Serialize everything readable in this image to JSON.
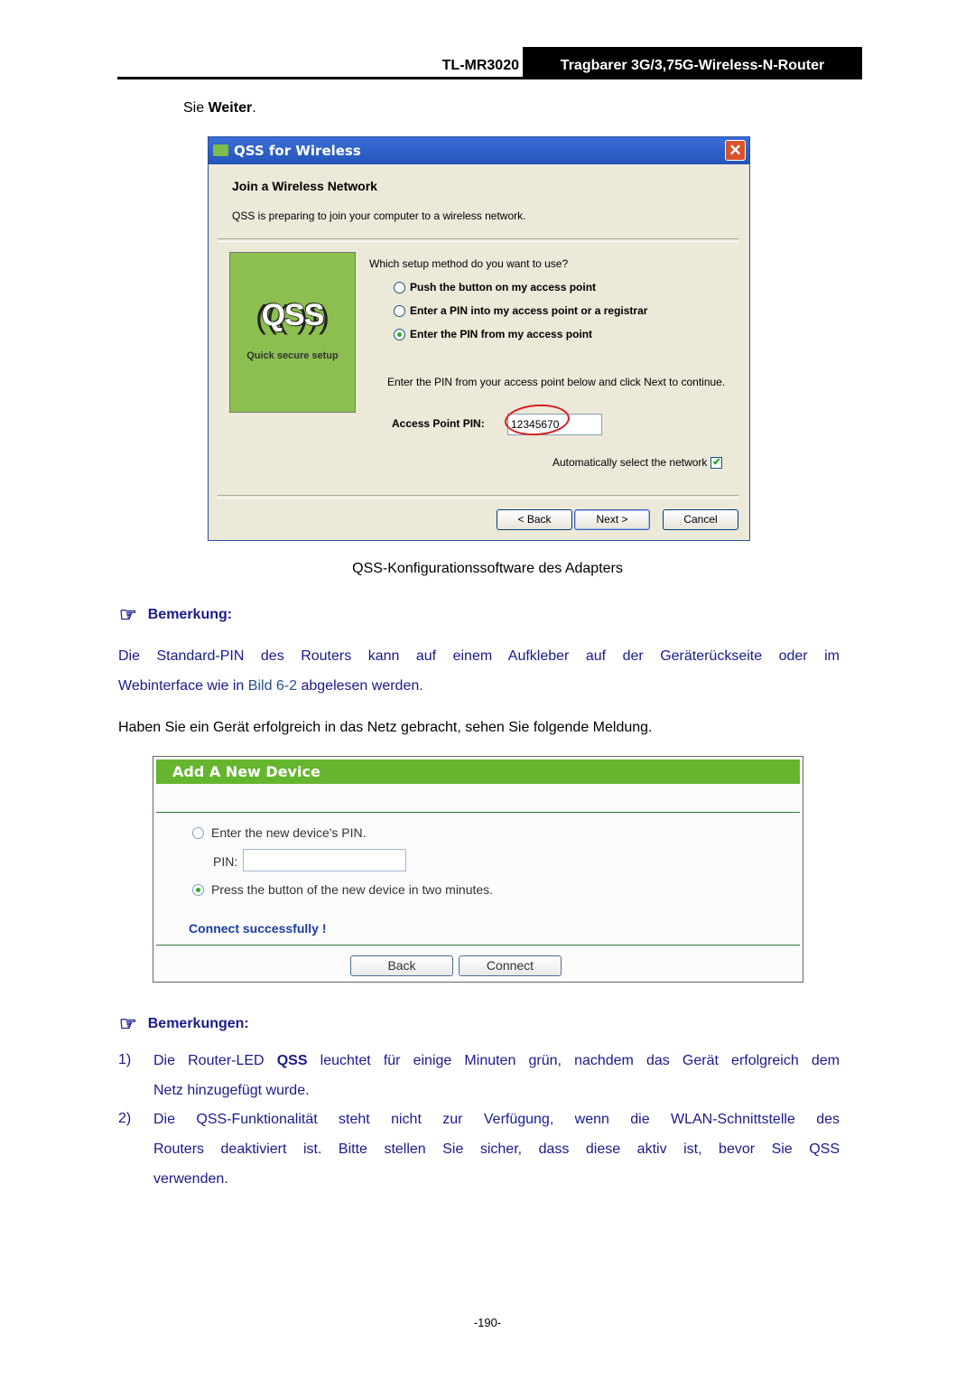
{
  "header": {
    "model": "TL-MR3020",
    "product": "Tragbarer 3G/3,75G-Wireless-N-Router"
  },
  "intro": {
    "prefix": "Sie ",
    "bold": "Weiter",
    "suffix": "."
  },
  "qss_dialog": {
    "title": "QSS for Wireless",
    "close_glyph": "✕",
    "heading": "Join a Wireless Network",
    "subtitle": "QSS is preparing to join your computer to a wireless network.",
    "logo_word": "QSS",
    "logo_arcs": "(((            )))",
    "logo_caption": "Quick secure setup",
    "question": "Which setup method do you want to use?",
    "options": [
      {
        "label": "Push the button on my access point",
        "selected": false
      },
      {
        "label": "Enter a PIN into my access point or a registrar",
        "selected": false
      },
      {
        "label": "Enter the PIN from my access point",
        "selected": true
      }
    ],
    "instruction": "Enter the PIN from your access point below and click Next to continue.",
    "pin_label": "Access Point PIN:",
    "pin_value": "12345670",
    "auto_select_label": "Automatically select the network",
    "auto_select_checked": true,
    "check_glyph": "✔",
    "buttons": {
      "back": "< Back",
      "next": "Next >",
      "cancel": "Cancel"
    }
  },
  "caption": "QSS-Konfigurationssoftware des Adapters",
  "note1": {
    "icon_glyph": "☞",
    "title": "Bemerkung:",
    "line1": "Die Standard-PIN des Routers kann auf einem Aufkleber auf der Geräterückseite oder im",
    "line2_prefix": "Webinterface wie in ",
    "line2_link": "Bild 6-2",
    "line2_suffix": " abgelesen werden."
  },
  "para": "Haben Sie ein Gerät erfolgreich in das Netz gebracht, sehen Sie folgende Meldung.",
  "web_panel": {
    "title": "Add A New Device",
    "option1": {
      "label": "Enter the new device's PIN.",
      "selected": false
    },
    "pin_label": "PIN:",
    "pin_value": "",
    "option2": {
      "label": "Press the button of the new device in two minutes.",
      "selected": true
    },
    "status": "Connect successfully !",
    "buttons": {
      "back": "Back",
      "connect": "Connect"
    }
  },
  "note2": {
    "icon_glyph": "☞",
    "title": "Bemerkungen:",
    "items": [
      {
        "num": "1)",
        "line1_prefix": "Die Router-LED ",
        "line1_bold": "QSS",
        "line1_suffix": " leuchtet für einige Minuten grün, nachdem das Gerät erfolgreich dem",
        "line2": "Netz hinzugefügt wurde."
      },
      {
        "num": "2)",
        "line1": "Die QSS-Funktionalität steht nicht zur Verfügung, wenn die WLAN-Schnittstelle des",
        "line2": "Routers deaktiviert ist. Bitte stellen Sie sicher, dass diese aktiv ist, bevor Sie QSS",
        "line3": "verwenden."
      }
    ]
  },
  "page_number": "-190-",
  "colors": {
    "note_text": "#1a1a8c",
    "link": "#28508c",
    "web_header_green": "#66b52f",
    "xp_titlebar": "#2454b8",
    "qss_logo_green": "#8cbf4f",
    "highlight_ellipse": "#d42020"
  }
}
